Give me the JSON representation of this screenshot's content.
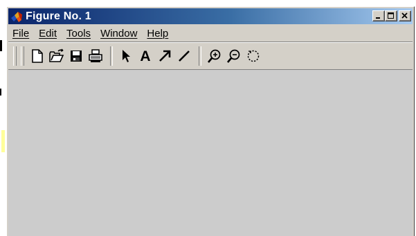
{
  "window": {
    "title": "Figure No. 1",
    "controls": {
      "minimize_icon": "minimize-icon",
      "maximize_icon": "maximize-icon",
      "close_icon": "close-icon"
    },
    "title_gradient_start": "#0a246a",
    "title_gradient_end": "#a6caf0",
    "face_color": "#d4d0c8",
    "client_color": "#cccccc"
  },
  "menu": {
    "items": [
      {
        "label": "File"
      },
      {
        "label": "Edit"
      },
      {
        "label": "Tools"
      },
      {
        "label": "Window"
      },
      {
        "label": "Help"
      }
    ]
  },
  "toolbar": {
    "buttons": [
      {
        "icon": "new-figure-icon"
      },
      {
        "icon": "open-file-icon"
      },
      {
        "icon": "save-icon"
      },
      {
        "icon": "print-icon"
      },
      {
        "icon": "edit-plot-arrow-icon"
      },
      {
        "icon": "insert-text-icon",
        "glyph": "A"
      },
      {
        "icon": "insert-arrow-icon"
      },
      {
        "icon": "insert-line-icon"
      },
      {
        "icon": "zoom-in-icon"
      },
      {
        "icon": "zoom-out-icon"
      },
      {
        "icon": "rotate-3d-icon"
      }
    ]
  }
}
